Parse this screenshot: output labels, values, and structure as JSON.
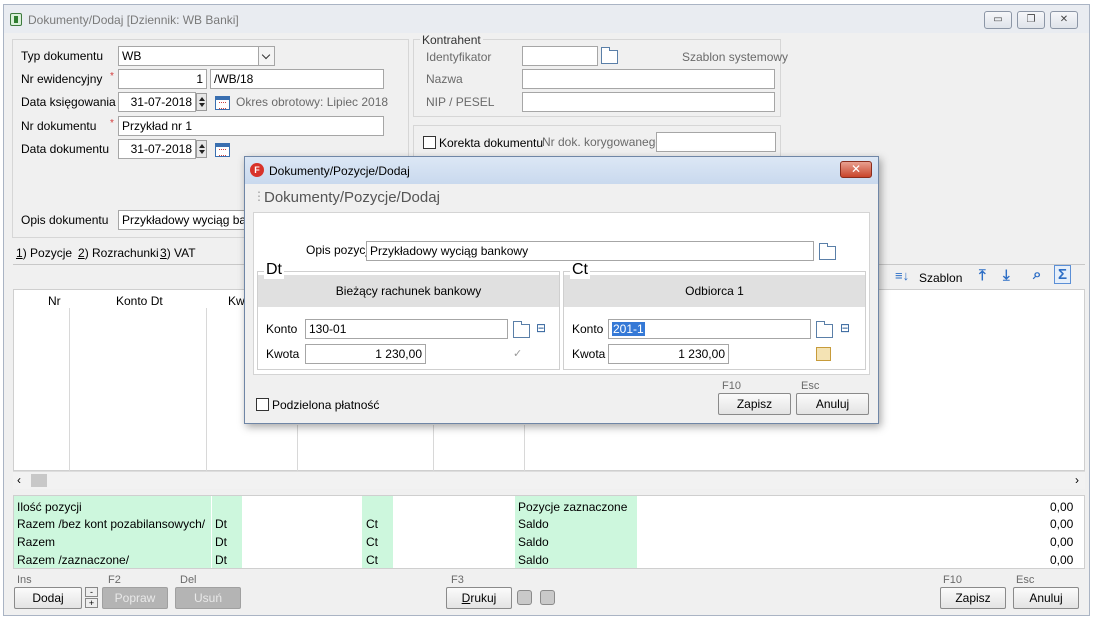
{
  "window": {
    "title": "Dokumenty/Dodaj [Dziennik: WB  Banki]",
    "controls": {
      "minimize": "▭",
      "restore": "❐",
      "close": "✕"
    }
  },
  "form": {
    "typ_label": "Typ dokumentu",
    "typ_value": "WB",
    "nr_ew_label": "Nr ewidencyjny",
    "nr_ew_num": "1",
    "nr_ew_suffix": "/WB/18",
    "data_ks_label": "Data księgowania",
    "data_ks_value": "31-07-2018",
    "okres": "Okres obrotowy: Lipiec 2018",
    "nr_dok_label": "Nr dokumentu",
    "nr_dok_value": "Przykład nr 1",
    "data_dok_label": "Data dokumentu",
    "data_dok_value": "31-07-2018",
    "opis_label": "Opis dokumentu",
    "opis_value": "Przykładowy wyciąg bankowy",
    "required_mark": "*"
  },
  "kontrahent": {
    "title": "Kontrahent",
    "identyfikator": "Identyfikator",
    "szablon": "Szablon systemowy",
    "nazwa": "Nazwa",
    "nip": "NIP / PESEL"
  },
  "korekta": {
    "label": "Korekta dokumentu",
    "nr_label": "Nr dok. korygowanego"
  },
  "tabs": [
    {
      "u": "1",
      "label": ") Pozycje"
    },
    {
      "u": "2",
      "label": ") Rozrachunki"
    },
    {
      "u": "3",
      "label": ") VAT"
    }
  ],
  "grid": {
    "col_nr": "Nr",
    "col_konto": "Konto Dt",
    "col_kw": "Kw",
    "szablon": "Szablon"
  },
  "summary": {
    "rows": [
      {
        "label": "Ilość pozycji",
        "dt": "",
        "ct": "",
        "right": "Pozycje zaznaczone",
        "value": "0,00"
      },
      {
        "label": "Razem /bez kont pozabilansowych/",
        "dt": "Dt",
        "ct": "Ct",
        "right": "Saldo",
        "value": "0,00"
      },
      {
        "label": "Razem",
        "dt": "Dt",
        "ct": "Ct",
        "right": "Saldo",
        "value": "0,00"
      },
      {
        "label": "Razem /zaznaczone/",
        "dt": "Dt",
        "ct": "Ct",
        "right": "Saldo",
        "value": "0,00"
      }
    ]
  },
  "bottom": {
    "ins": "Ins",
    "f2": "F2",
    "del": "Del",
    "f3": "F3",
    "f10": "F10",
    "esc": "Esc",
    "dodaj": "Dodaj",
    "popraw": "Popraw",
    "usun": "Usuń",
    "drukuj_u": "D",
    "drukuj_rest": "rukuj",
    "zapisz": "Zapisz",
    "anuluj": "Anuluj"
  },
  "dialog": {
    "title": "Dokumenty/Pozycje/Dodaj",
    "header": "Dokumenty/Pozycje/Dodaj",
    "opis_label": "Opis pozycji",
    "opis_value": "Przykładowy wyciąg bankowy",
    "dt": {
      "title": "Dt",
      "head": "Bieżący rachunek bankowy",
      "konto_label": "Konto",
      "konto_value": "130-01",
      "kwota_label": "Kwota",
      "kwota_value": "1 230,00"
    },
    "ct": {
      "title": "Ct",
      "head": "Odbiorca 1",
      "konto_label": "Konto",
      "konto_value": "201-1",
      "kwota_label": "Kwota",
      "kwota_value": "1 230,00"
    },
    "podzielona": "Podzielona płatność",
    "f10": "F10",
    "esc": "Esc",
    "zapisz": "Zapisz",
    "anuluj": "Anuluj",
    "close": "✕"
  }
}
